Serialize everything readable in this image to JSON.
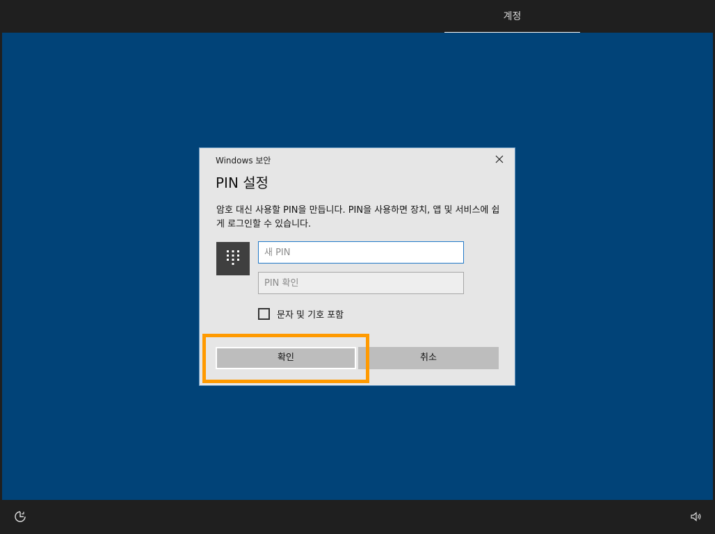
{
  "top_bar": {
    "tab_label": "계정"
  },
  "dialog": {
    "caption": "Windows 보안",
    "title": "PIN 설정",
    "description": "암호 대신 사용할 PIN을 만듭니다. PIN을 사용하면 장치, 앱 및 서비스에 쉽게 로그인할 수 있습니다.",
    "new_pin_placeholder": "새 PIN",
    "confirm_pin_placeholder": "PIN 확인",
    "checkbox_label": "문자 및 기호 포함",
    "ok_label": "확인",
    "cancel_label": "취소"
  },
  "icons": {
    "close": "close-icon",
    "keypad": "keypad-icon",
    "ease_of_access": "ease-of-access-icon",
    "volume": "volume-icon"
  },
  "colors": {
    "background": "#014378",
    "bar": "#1f1f1f",
    "dialog": "#e6e6e6",
    "button": "#bdbdbd",
    "highlight": "#ff9a00",
    "input_focus": "#1f78c8"
  }
}
